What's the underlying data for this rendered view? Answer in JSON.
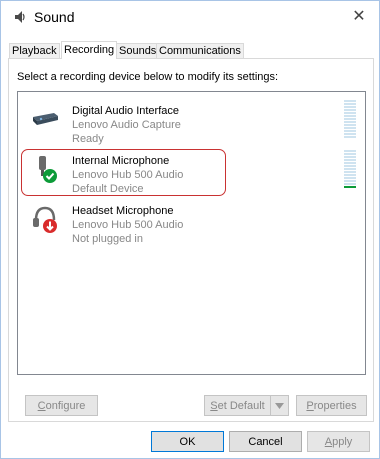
{
  "window": {
    "title": "Sound",
    "close_symbol": "✕"
  },
  "tabs": [
    {
      "label": "Playback",
      "active": false
    },
    {
      "label": "Recording",
      "active": true
    },
    {
      "label": "Sounds",
      "active": false
    },
    {
      "label": "Communications",
      "active": false
    }
  ],
  "instruction": "Select a recording device below to modify its settings:",
  "devices": [
    {
      "name": "Digital Audio Interface",
      "sub": "Lenovo Audio Capture",
      "status": "Ready",
      "icon": "audio-interface-icon",
      "meter_level": 0
    },
    {
      "name": "Internal Microphone",
      "sub": "Lenovo Hub 500 Audio",
      "status": "Default Device",
      "icon": "microphone-default-icon",
      "meter_level": 0.08
    },
    {
      "name": "Headset Microphone",
      "sub": "Lenovo Hub 500 Audio",
      "status": "Not plugged in",
      "icon": "headset-unplugged-icon",
      "meter_level": 0
    }
  ],
  "buttons": {
    "configure": {
      "prefix": "",
      "accel": "C",
      "rest": "onfigure",
      "enabled": false
    },
    "set_default": {
      "prefix": "",
      "accel": "S",
      "rest": "et Default",
      "enabled": false
    },
    "properties": {
      "prefix": "",
      "accel": "P",
      "rest": "roperties",
      "enabled": false
    },
    "ok": {
      "label": "OK",
      "enabled": true
    },
    "cancel": {
      "label": "Cancel",
      "enabled": true
    },
    "apply": {
      "prefix": "",
      "accel": "A",
      "rest": "pply",
      "enabled": false
    }
  },
  "colors": {
    "highlight_border": "#c93232",
    "meter_active": "#0c9b38",
    "meter_inactive": "#cfe3f0"
  }
}
